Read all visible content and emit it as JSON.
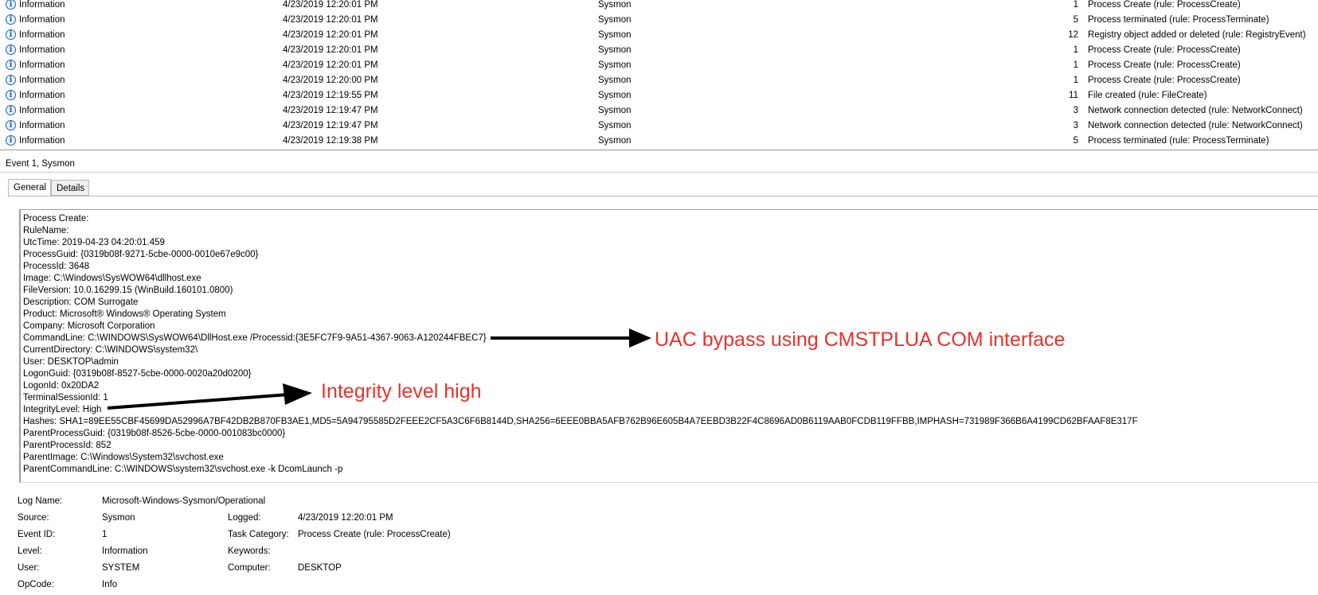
{
  "event_list": [
    {
      "level": "Information",
      "date": "4/23/2019 12:20:01 PM",
      "source": "Sysmon",
      "event_id": "1",
      "task": "Process Create (rule: ProcessCreate)"
    },
    {
      "level": "Information",
      "date": "4/23/2019 12:20:01 PM",
      "source": "Sysmon",
      "event_id": "5",
      "task": "Process terminated (rule: ProcessTerminate)"
    },
    {
      "level": "Information",
      "date": "4/23/2019 12:20:01 PM",
      "source": "Sysmon",
      "event_id": "12",
      "task": "Registry object added or deleted (rule: RegistryEvent)"
    },
    {
      "level": "Information",
      "date": "4/23/2019 12:20:01 PM",
      "source": "Sysmon",
      "event_id": "1",
      "task": "Process Create (rule: ProcessCreate)"
    },
    {
      "level": "Information",
      "date": "4/23/2019 12:20:01 PM",
      "source": "Sysmon",
      "event_id": "1",
      "task": "Process Create (rule: ProcessCreate)"
    },
    {
      "level": "Information",
      "date": "4/23/2019 12:20:00 PM",
      "source": "Sysmon",
      "event_id": "1",
      "task": "Process Create (rule: ProcessCreate)"
    },
    {
      "level": "Information",
      "date": "4/23/2019 12:19:55 PM",
      "source": "Sysmon",
      "event_id": "11",
      "task": "File created (rule: FileCreate)"
    },
    {
      "level": "Information",
      "date": "4/23/2019 12:19:47 PM",
      "source": "Sysmon",
      "event_id": "3",
      "task": "Network connection detected (rule: NetworkConnect)"
    },
    {
      "level": "Information",
      "date": "4/23/2019 12:19:47 PM",
      "source": "Sysmon",
      "event_id": "3",
      "task": "Network connection detected (rule: NetworkConnect)"
    },
    {
      "level": "Information",
      "date": "4/23/2019 12:19:38 PM",
      "source": "Sysmon",
      "event_id": "5",
      "task": "Process terminated (rule: ProcessTerminate)"
    }
  ],
  "info_icon_glyph": "i",
  "event_header": "Event 1, Sysmon",
  "tabs": {
    "general": "General",
    "details": "Details"
  },
  "details_lines": [
    "Process Create:",
    "RuleName:",
    "UtcTime: 2019-04-23 04:20:01.459",
    "ProcessGuid: {0319b08f-9271-5cbe-0000-0010e67e9c00}",
    "ProcessId: 3648",
    "Image: C:\\Windows\\SysWOW64\\dllhost.exe",
    "FileVersion: 10.0.16299.15 (WinBuild.160101.0800)",
    "Description: COM Surrogate",
    "Product: Microsoft® Windows® Operating System",
    "Company: Microsoft Corporation",
    "CommandLine: C:\\WINDOWS\\SysWOW64\\DllHost.exe /Processid:{3E5FC7F9-9A51-4367-9063-A120244FBEC7}",
    "CurrentDirectory: C:\\WINDOWS\\system32\\",
    "User: DESKTOP\\admin",
    "LogonGuid: {0319b08f-8527-5cbe-0000-0020a20d0200}",
    "LogonId: 0x20DA2",
    "TerminalSessionId: 1",
    "IntegrityLevel: High",
    "Hashes: SHA1=89EE55CBF45699DA52996A7BF42DB2B870FB3AE1,MD5=5A94795585D2FEEE2CF5A3C6F6B8144D,SHA256=6EEE0BBA5AFB762B96E605B4A7EEBD3B22F4C8696AD0B6119AAB0FCDB119FFBB,IMPHASH=731989F366B6A4199CD62BFAAF8E317F",
    "ParentProcessGuid: {0319b08f-8526-5cbe-0000-001083bc0000}",
    "ParentProcessId: 852",
    "ParentImage: C:\\Windows\\System32\\svchost.exe",
    "ParentCommandLine: C:\\WINDOWS\\system32\\svchost.exe -k DcomLaunch -p"
  ],
  "annotations": {
    "uac": "UAC bypass using CMSTPLUA COM interface",
    "integrity": "Integrity level high",
    "color": "#e8322b"
  },
  "properties": {
    "log_name_label": "Log Name:",
    "log_name": "Microsoft-Windows-Sysmon/Operational",
    "source_label": "Source:",
    "source": "Sysmon",
    "logged_label": "Logged:",
    "logged": "4/23/2019 12:20:01 PM",
    "event_id_label": "Event ID:",
    "event_id": "1",
    "task_category_label": "Task Category:",
    "task_category": "Process Create (rule: ProcessCreate)",
    "level_label": "Level:",
    "level": "Information",
    "keywords_label": "Keywords:",
    "keywords": "",
    "user_label": "User:",
    "user": "SYSTEM",
    "computer_label": "Computer:",
    "computer": "DESKTOP",
    "opcode_label": "OpCode:",
    "opcode": "Info"
  }
}
